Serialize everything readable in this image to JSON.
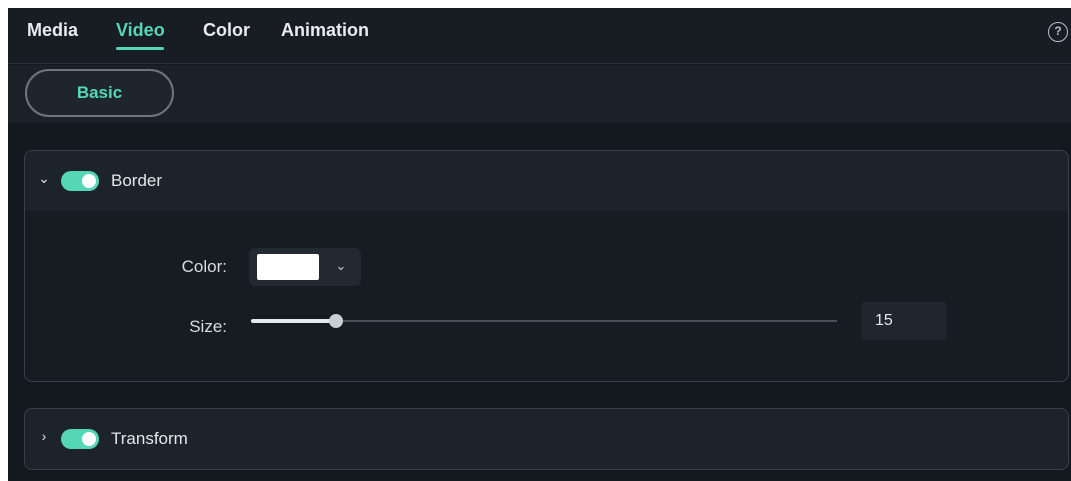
{
  "tabs": [
    {
      "label": "Media",
      "active": false
    },
    {
      "label": "Video",
      "active": true
    },
    {
      "label": "Color",
      "active": false
    },
    {
      "label": "Animation",
      "active": false
    }
  ],
  "help_icon": {
    "glyph": "?",
    "icon": "question-circle-icon"
  },
  "subtabs": {
    "basic_label": "Basic"
  },
  "border_panel": {
    "title": "Border",
    "expanded": true,
    "enabled": true,
    "chevron": "⌄",
    "color_label": "Color:",
    "color_value": "#ffffff",
    "color_chevron": "⌄",
    "size_label": "Size:",
    "size_value": "15",
    "size_fraction": 0.145
  },
  "transform_panel": {
    "title": "Transform",
    "expanded": false,
    "enabled": true,
    "chevron": "›"
  },
  "colors": {
    "accent": "#55d6b7",
    "background": "#141920",
    "panel": "#171c22"
  }
}
